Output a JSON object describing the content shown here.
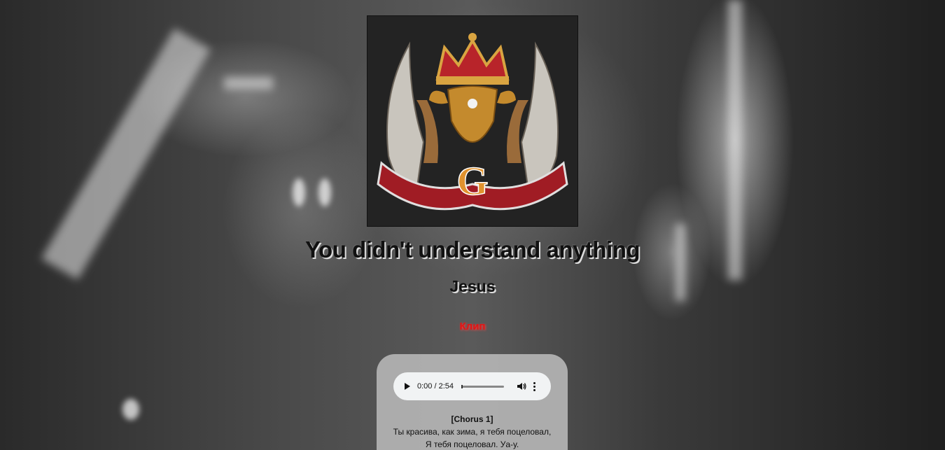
{
  "track": {
    "title": "You didn't understand anything",
    "artist": "Jesus",
    "clip_label": "Клип"
  },
  "player": {
    "time": "0:00 / 2:54",
    "progress": 0,
    "icons": {
      "play": "play-icon",
      "volume": "volume-icon",
      "more": "more-options-icon"
    }
  },
  "lyrics": {
    "section": "[Chorus 1]",
    "lines": [
      "Ты красива, как зима, я тебя поцеловал,",
      "Я тебя поцеловал. Уа-у."
    ]
  },
  "colors": {
    "clip_link": "#e01515",
    "panel": "#b4b4b4",
    "player_bg": "#f1f3f4"
  }
}
